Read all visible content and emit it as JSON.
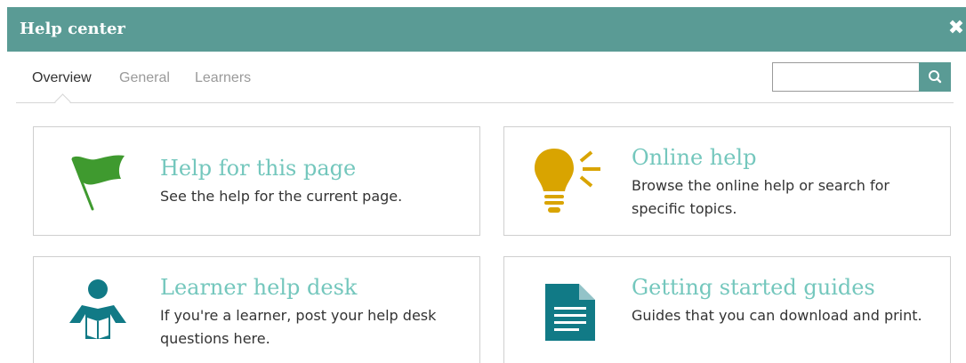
{
  "window": {
    "title": "Help center",
    "close_icon": "close-icon"
  },
  "tabs": [
    {
      "label": "Overview",
      "active": true
    },
    {
      "label": "General",
      "active": false
    },
    {
      "label": "Learners",
      "active": false
    }
  ],
  "search": {
    "value": "",
    "placeholder": "",
    "icon": "search-icon"
  },
  "cards": [
    {
      "title": "Help for this page",
      "description": "See the help for the current page.",
      "icon": "flag-icon",
      "icon_color": "#3f9a2f"
    },
    {
      "title": "Online help",
      "description": "Browse the online help or search for specific topics.",
      "icon": "lightbulb-icon",
      "icon_color": "#d9a400"
    },
    {
      "title": "Learner help desk",
      "description": "If you're a learner, post your help desk questions here.",
      "icon": "reader-icon",
      "icon_color": "#117a86"
    },
    {
      "title": "Getting started guides",
      "description": "Guides that you can download and print.",
      "icon": "document-icon",
      "icon_color": "#117a86"
    }
  ],
  "colors": {
    "header": "#5a9b95",
    "accent_text": "#74c7bd"
  }
}
